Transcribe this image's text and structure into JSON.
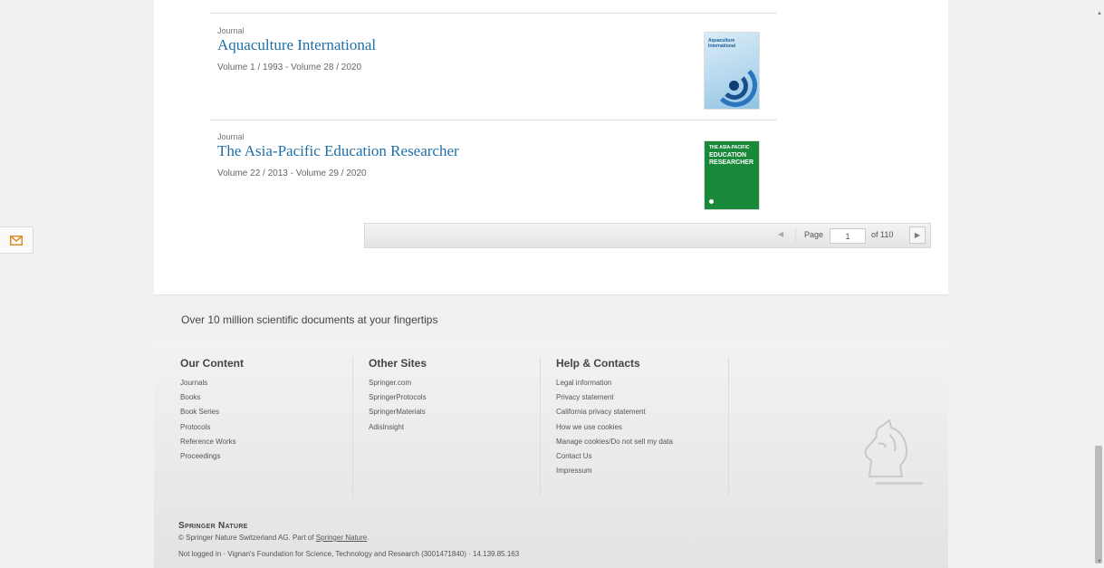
{
  "results": [
    {
      "type": "Journal",
      "title": "Aquaculture International",
      "volume": "Volume 1 / 1993 - Volume 28 / 2020",
      "cover_text": "Aquaculture International"
    },
    {
      "type": "Journal",
      "title": "The Asia-Pacific Education Researcher",
      "volume": "Volume 22 / 2013 - Volume 29 / 2020",
      "cover_text_1": "THE ASIA-PACIFIC",
      "cover_text_2": "EDUCATION RESEARCHER"
    }
  ],
  "pager": {
    "prev": "◀",
    "page_label": "Page",
    "page_value": "1",
    "of_label": "of 110",
    "next": "▶"
  },
  "tagline": "Over 10 million scientific documents at your fingertips",
  "footer": {
    "our_content": {
      "heading": "Our Content",
      "items": [
        "Journals",
        "Books",
        "Book Series",
        "Protocols",
        "Reference Works",
        "Proceedings"
      ]
    },
    "other_sites": {
      "heading": "Other Sites",
      "items": [
        "Springer.com",
        "SpringerProtocols",
        "SpringerMaterials",
        "AdisInsight"
      ]
    },
    "help": {
      "heading": "Help & Contacts",
      "items": [
        "Legal information",
        "Privacy statement",
        "California privacy statement",
        "How we use cookies",
        "Manage cookies/Do not sell my data",
        "Contact Us",
        "Impressum"
      ]
    },
    "brand": "Springer Nature",
    "copyright_prefix": "© Springer Nature Switzerland AG. Part of ",
    "copyright_link": "Springer Nature",
    "copyright_suffix": ".",
    "login_line": "Not logged in · Vignan's Foundation for Science, Technology and Research (3001471840) · 14.139.85.163"
  },
  "colors": {
    "link": "#1e6fa8",
    "page_bg": "#f1f1f1",
    "footer_bg": "#e9e9e9"
  }
}
